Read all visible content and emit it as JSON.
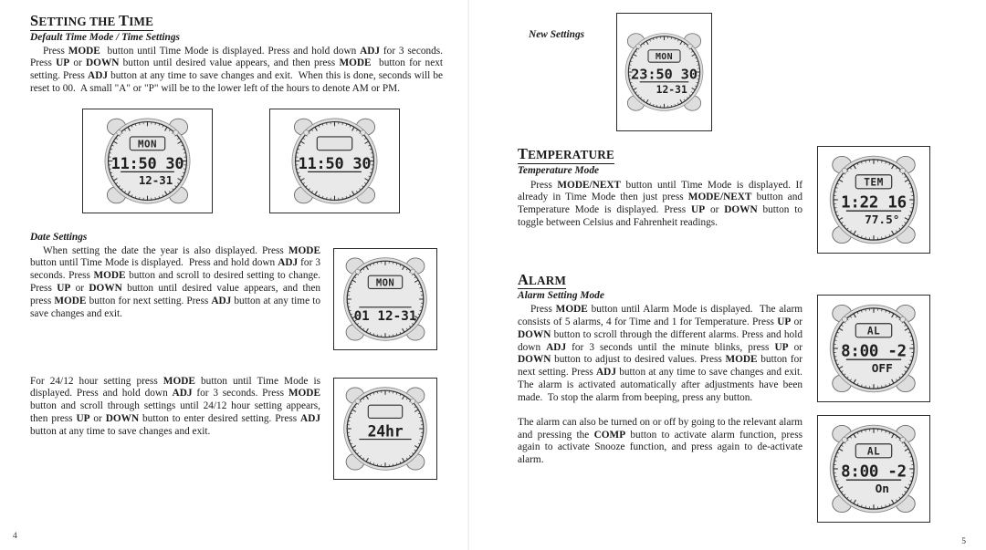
{
  "document": {
    "page_left_number": "4",
    "page_right_number": "5"
  },
  "left_page": {
    "section_setting_time": {
      "heading_first": "S",
      "heading_rest1": "ETTING THE ",
      "heading_cap2": "T",
      "heading_rest2": "IME",
      "heading_full": "SETTING THE TIME",
      "subheading": "Default Time Mode / Time Settings",
      "paragraph_html": "Press <b>MODE</b>&nbsp; button until Time Mode is displayed. Press and hold down <b>ADJ</b> for 3 seconds. Press <b>UP</b> or <b>DOWN</b> button until desired value appears, and then press <b>MODE</b>&nbsp; button for next setting. Press <b>ADJ</b> button at any time to save changes and exit.&nbsp; When this is done, seconds will be reset to 00.&nbsp; A small \"A\" or \"P\" will be to the lower left of the hours to denote AM or PM."
    },
    "section_date_settings": {
      "subheading": "Date Settings",
      "paragraph_html": "When setting the date the year is also displayed. Press <b>MODE</b> button until Time Mode is displayed.&nbsp; Press and hold down <b>ADJ</b> for 3 seconds. Press <b>MODE</b> button and scroll to desired setting to change. Press <b>UP</b> or <b>DOWN</b> button until desired value appears, and then press <b>MODE</b> button for next setting. Press <b>ADJ</b> button at any time to save changes and exit."
    },
    "section_24_12": {
      "paragraph_html": "For 24/12 hour setting press <b>MODE</b> button until Time Mode is displayed. Press and hold down <b>ADJ</b> for 3 seconds. Press <b>MODE</b> button and scroll through settings until 24/12 hour setting appears, then press <b>UP</b> or <b>DOWN</b> button to enter desired setting. Press <b>ADJ</b> button at any time to save changes and exit."
    },
    "watch_time_mode": {
      "top_label": "MON",
      "main_line": "11:50 30",
      "sub_line": "12-31",
      "top_label_visible": true,
      "sub_line_visible": true
    },
    "watch_time_blank": {
      "top_label": "",
      "main_line": "11:50 30",
      "sub_line": "",
      "top_label_visible": false,
      "sub_line_visible": false
    },
    "watch_date_mode": {
      "top_label": "MON",
      "main_line": "",
      "sub_line": "01 12-31",
      "top_label_visible": true,
      "sub_line_visible": true
    },
    "watch_24hr": {
      "top_label": "",
      "main_line": "24hr",
      "sub_line": "",
      "top_label_visible": false,
      "sub_line_visible": false
    }
  },
  "right_page": {
    "new_settings_label": "New Settings",
    "watch_new_settings": {
      "top_label": "MON",
      "main_line": "23:50 30",
      "sub_line": "12-31"
    },
    "section_temperature": {
      "heading_first": "T",
      "heading_rest": "EMPERATURE",
      "heading_full": "TEMPERATURE",
      "subheading": "Temperature Mode",
      "paragraph_html": "Press <b>MODE/NEXT</b> button until Time Mode is displayed. If already in Time Mode then just press <b>MODE/NEXT</b> button and Temperature Mode is displayed. Press <b>UP</b> or <b>DOWN</b> button to toggle between Celsius and Fahrenheit readings."
    },
    "watch_temperature": {
      "top_label": "TEM",
      "main_line": "1:22 16",
      "sub_line": "77.5°"
    },
    "section_alarm": {
      "heading_first": "A",
      "heading_rest": "LARM",
      "heading_full": "ALARM",
      "subheading": "Alarm Setting Mode",
      "paragraph_html": "Press <b>MODE</b> button until Alarm Mode is displayed.&nbsp; The alarm consists of 5 alarms, 4 for Time and 1 for Temperature. Press <b>UP</b> or <b>DOWN</b> button to scroll through the different alarms. Press and hold down <b>ADJ</b> for 3 seconds until the minute blinks, press <b>UP</b> or <b>DOWN</b> button to adjust to desired values. Press <b>MODE</b> button for next setting. Press <b>ADJ</b> button at any time to save changes and exit. The alarm is activated automatically after adjustments have been made.&nbsp; To stop the alarm from beeping, press any button.",
      "paragraph2_html": "The alarm can also be turned on or off by going to the relevant alarm and pressing the <b>COMP</b> button to activate alarm function, press again to activate Snooze function, and press again to de-activate alarm."
    },
    "watch_alarm_off": {
      "top_label": "AL",
      "main_line": "8:00 -2",
      "sub_line": "OFF"
    },
    "watch_alarm_on": {
      "top_label": "AL",
      "main_line": "8:00 -2",
      "sub_line": "On"
    }
  },
  "colors": {
    "ink": "#1a1a1a",
    "paper": "#ffffff",
    "lcd_body": "#e9e9e9",
    "lcd_outline": "#3a3a3a"
  }
}
